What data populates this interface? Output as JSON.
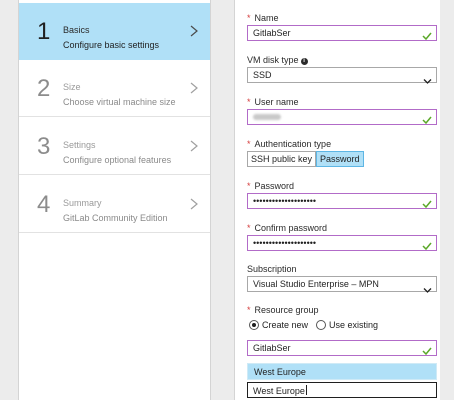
{
  "steps": [
    {
      "number": "1",
      "title": "Basics",
      "subtitle": "Configure basic settings"
    },
    {
      "number": "2",
      "title": "Size",
      "subtitle": "Choose virtual machine size"
    },
    {
      "number": "3",
      "title": "Settings",
      "subtitle": "Configure optional features"
    },
    {
      "number": "4",
      "title": "Summary",
      "subtitle": "GitLab Community Edition"
    }
  ],
  "form": {
    "name_label": "Name",
    "name_value": "GitlabSer",
    "disk_label": "VM disk type",
    "disk_value": "SSD",
    "user_label": "User name",
    "auth_label": "Authentication type",
    "auth_ssh": "SSH public key",
    "auth_password": "Password",
    "password_label": "Password",
    "password_value": "••••••••••••••••••••",
    "confirm_label": "Confirm password",
    "confirm_value": "••••••••••••••••••••",
    "subscription_label": "Subscription",
    "subscription_value": "Visual Studio Enterprise – MPN",
    "rg_label": "Resource group",
    "rg_create": "Create new",
    "rg_existing": "Use existing",
    "rg_value": "GitlabSer",
    "location_option": "West Europe",
    "location_value": "West Europe"
  },
  "colors": {
    "active_step_bg": "#b0e0f7",
    "required_star": "#d43a3a",
    "valid_border": "#b26bc8",
    "valid_check": "#5ba829"
  }
}
